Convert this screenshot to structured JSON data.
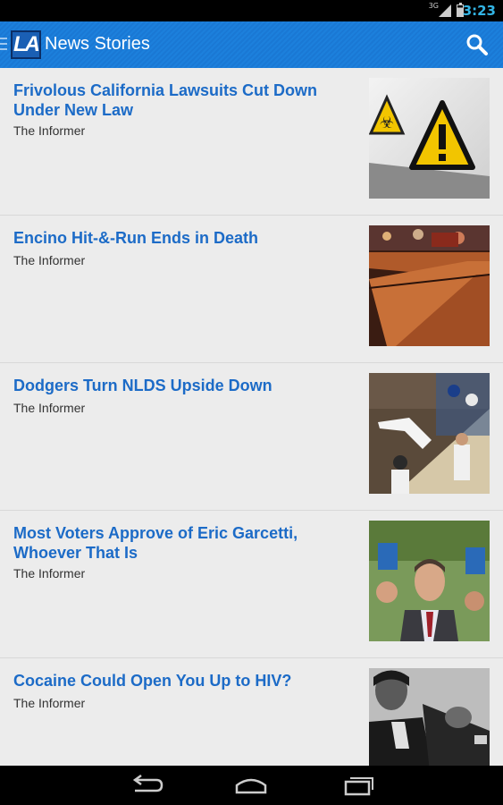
{
  "status_bar": {
    "time": "3:23",
    "network": "3G"
  },
  "app_bar": {
    "title": "News Stories",
    "logo_text": "LA"
  },
  "stories": [
    {
      "title": "Frivolous California Lawsuits Cut Down Under New Law",
      "source": "The Informer",
      "thumbnail": "warning-signs-image"
    },
    {
      "title": "Encino Hit-&-Run Ends in Death",
      "source": "The Informer",
      "thumbnail": "street-night-image"
    },
    {
      "title": "Dodgers Turn NLDS Upside Down",
      "source": "The Informer",
      "thumbnail": "stadium-fans-image"
    },
    {
      "title": "Most Voters Approve of Eric Garcetti, Whoever That Is",
      "source": "The Informer",
      "thumbnail": "politician-crowd-image"
    },
    {
      "title": "Cocaine Could Open You Up to HIV?",
      "source": "The Informer",
      "thumbnail": "film-still-image"
    }
  ],
  "colors": {
    "accent": "#1a78d4",
    "title_text": "#1c6bc7",
    "status_clock": "#33b5e5"
  },
  "nav": {
    "back": "back-icon",
    "home": "home-icon",
    "recents": "recents-icon"
  }
}
